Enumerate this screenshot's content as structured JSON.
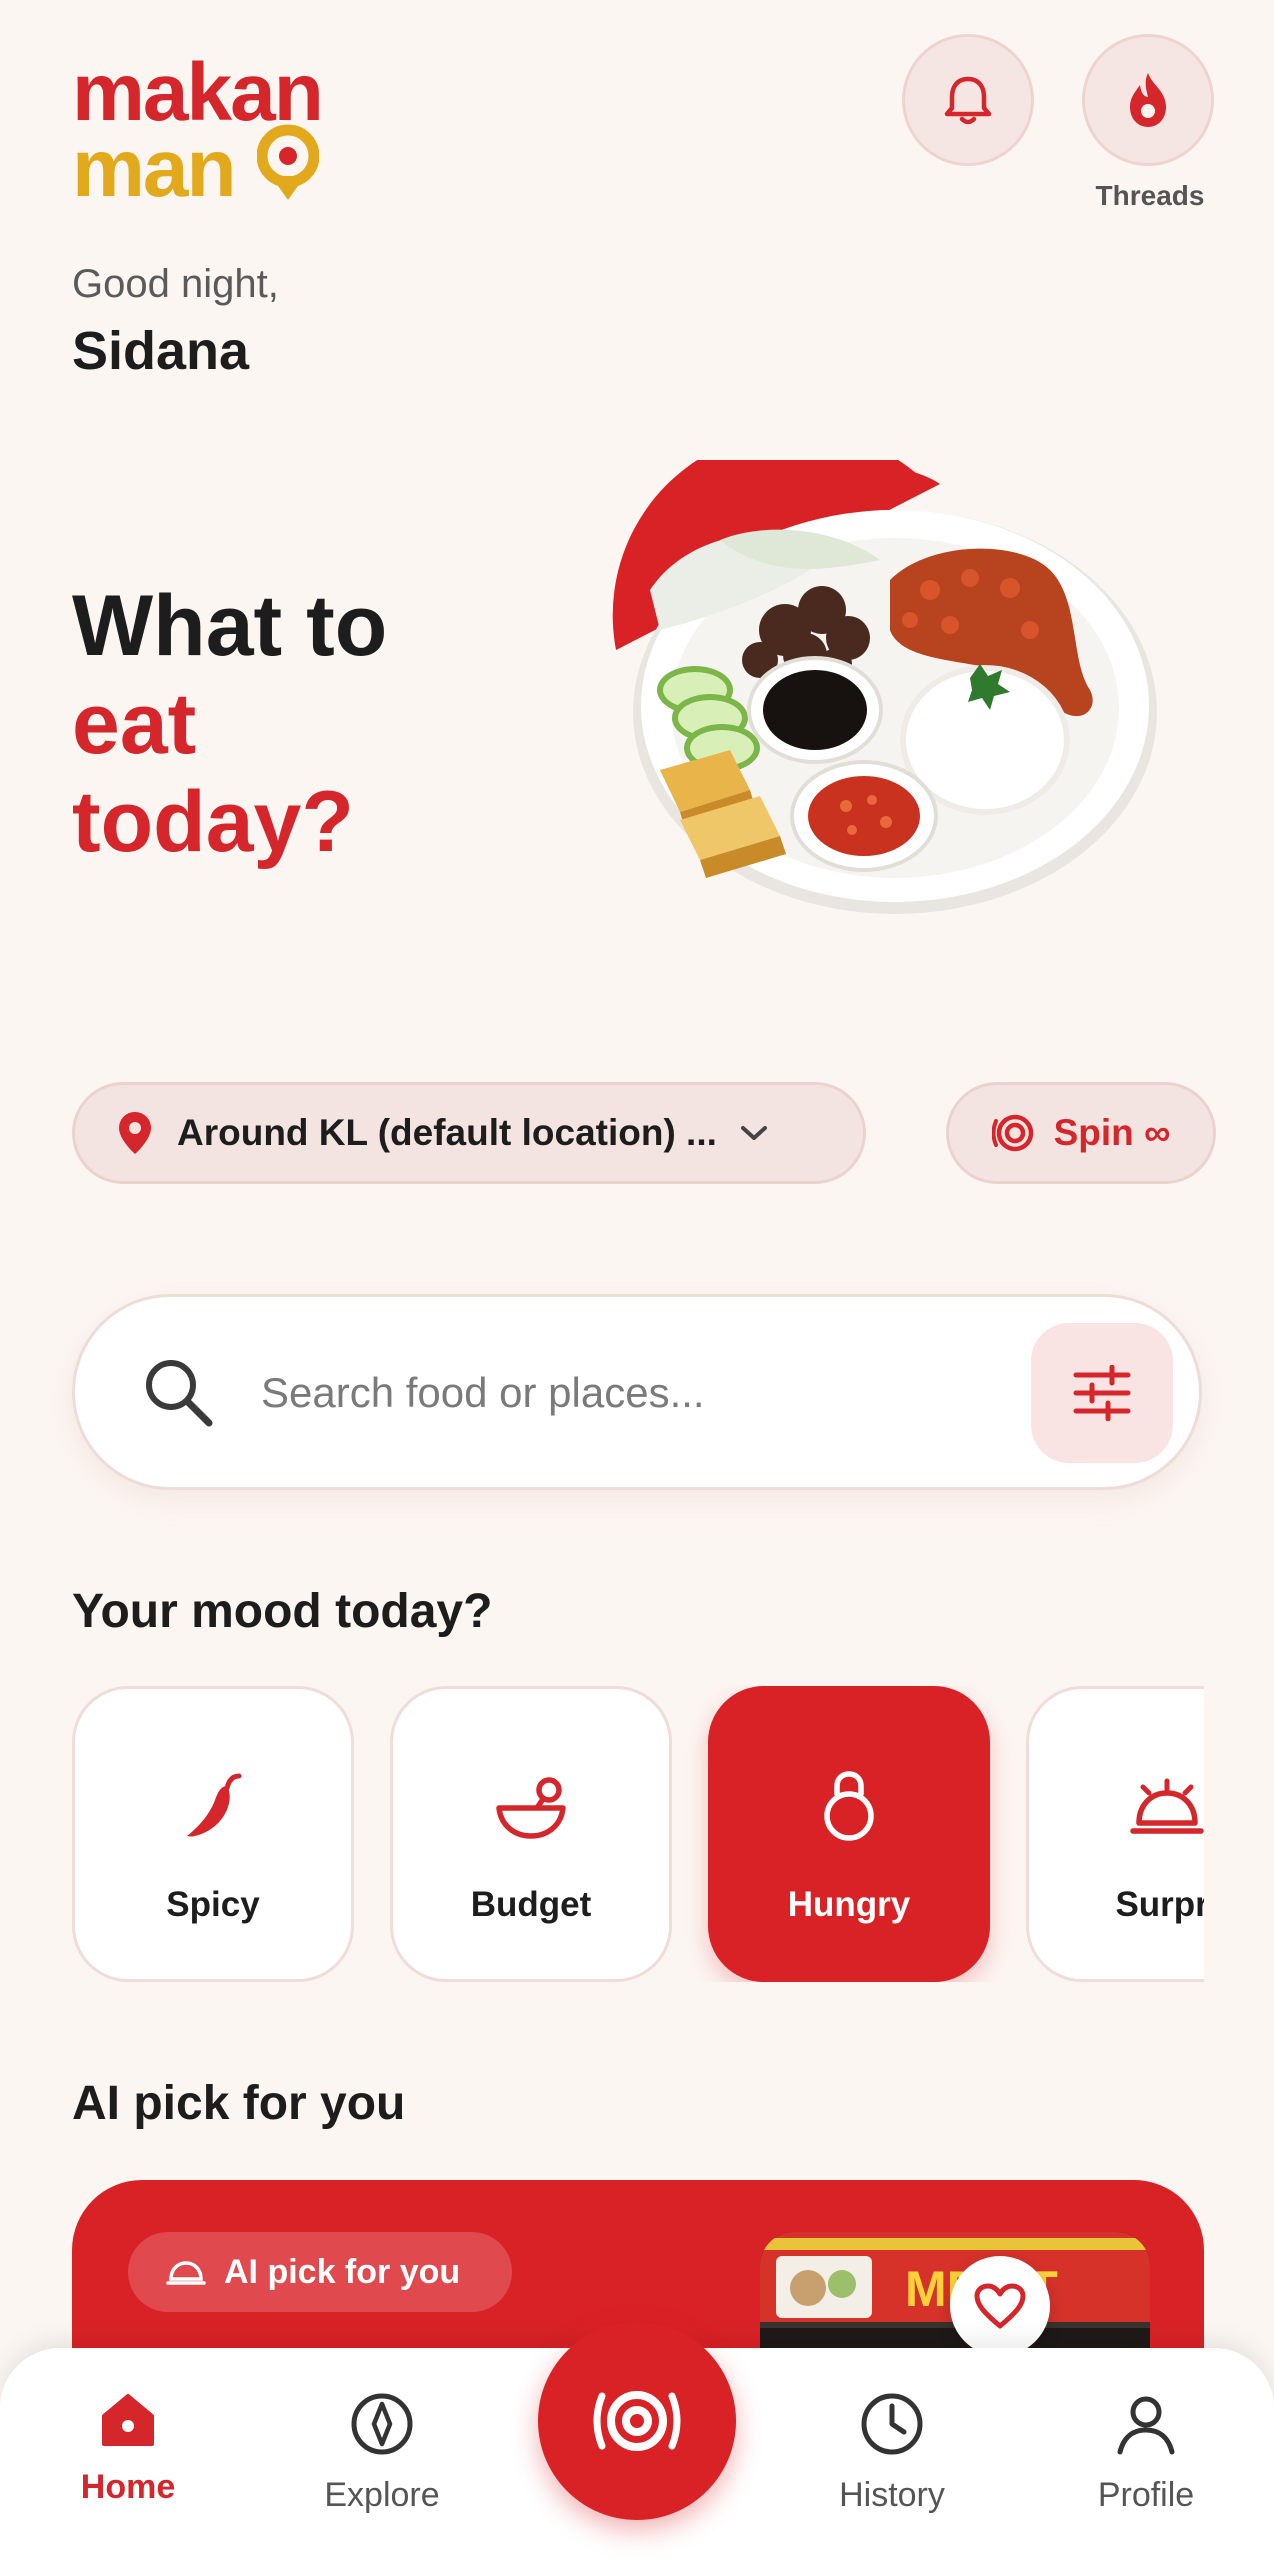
{
  "logo": {
    "line1": "makan",
    "line2": "man"
  },
  "header": {
    "threads_label": "Threads"
  },
  "greeting": {
    "salutation": "Good night,",
    "name": "Sidana"
  },
  "hero": {
    "line1": "What to",
    "line2": "eat",
    "line3": "today?"
  },
  "location": {
    "label": "Around KL (default location) ..."
  },
  "spin": {
    "label": "Spin ∞"
  },
  "search": {
    "placeholder": "Search food or places..."
  },
  "mood": {
    "title": "Your mood today?",
    "items": [
      {
        "label": "Spicy",
        "icon": "chili-icon",
        "active": false
      },
      {
        "label": "Budget",
        "icon": "bowl-icon",
        "active": false
      },
      {
        "label": "Hungry",
        "icon": "hungry-icon",
        "active": true
      },
      {
        "label": "Surpri",
        "icon": "cloche-icon",
        "active": false
      }
    ]
  },
  "ai_pick": {
    "title": "AI pick for you",
    "chip_label": "AI pick for you",
    "photo_sign": "MEE T"
  },
  "bottom_nav": {
    "items": [
      {
        "label": "Home",
        "icon": "home-icon",
        "active": true
      },
      {
        "label": "Explore",
        "icon": "compass-icon",
        "active": false
      },
      {
        "label": "History",
        "icon": "clock-icon",
        "active": false
      },
      {
        "label": "Profile",
        "icon": "profile-icon",
        "active": false
      }
    ],
    "center_icon": "spin-wheel-icon"
  },
  "colors": {
    "primary": "#d92226",
    "brand_red": "#d4262b",
    "brand_yellow": "#e2a91c",
    "background": "#fcf6f3"
  }
}
